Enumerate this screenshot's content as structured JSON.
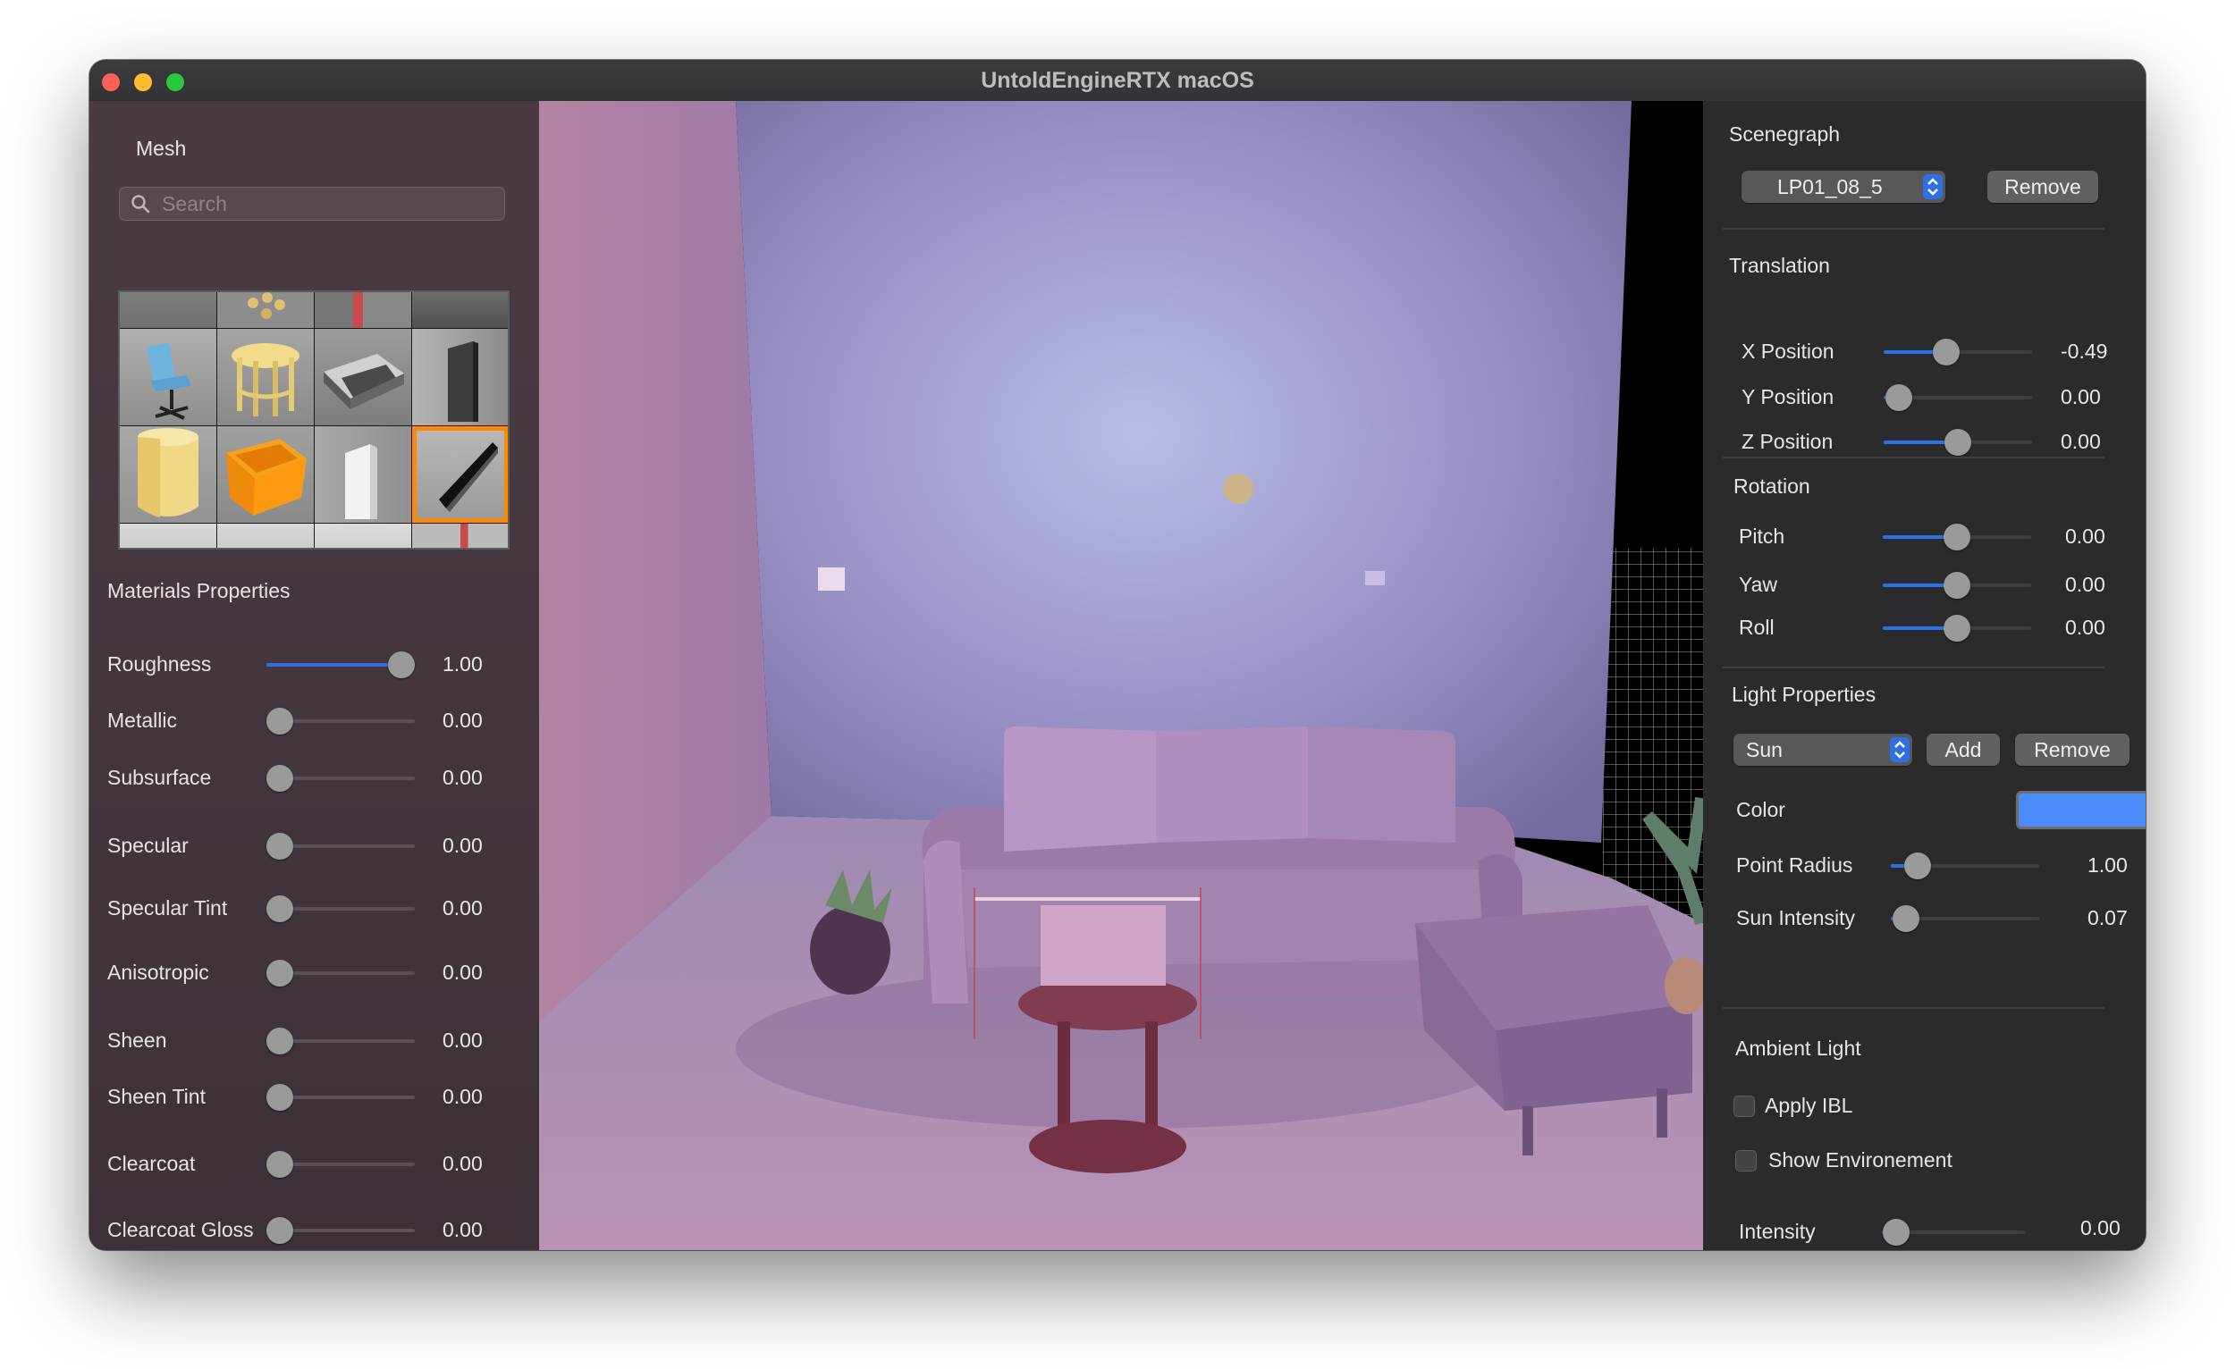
{
  "window": {
    "title": "UntoldEngineRTX macOS"
  },
  "left_panel": {
    "mesh_label": "Mesh",
    "search_placeholder": "Search",
    "materials_title": "Materials Properties",
    "materials": [
      {
        "label": "Roughness",
        "value": "1.00",
        "level": 1.0
      },
      {
        "label": "Metallic",
        "value": "0.00",
        "level": 0.0
      },
      {
        "label": "Subsurface",
        "value": "0.00",
        "level": 0.0
      },
      {
        "label": "Specular",
        "value": "0.00",
        "level": 0.0
      },
      {
        "label": "Specular Tint",
        "value": "0.00",
        "level": 0.0
      },
      {
        "label": "Anisotropic",
        "value": "0.00",
        "level": 0.0
      },
      {
        "label": "Sheen",
        "value": "0.00",
        "level": 0.0
      },
      {
        "label": "Sheen Tint",
        "value": "0.00",
        "level": 0.0
      },
      {
        "label": "Clearcoat",
        "value": "0.00",
        "level": 0.0
      },
      {
        "label": "Clearcoat Gloss",
        "value": "0.00",
        "level": 0.0
      }
    ]
  },
  "right_panel": {
    "scenegraph_title": "Scenegraph",
    "scenegraph_selected": "LP01_08_5",
    "remove_label": "Remove",
    "translation_title": "Translation",
    "translation": [
      {
        "label": "X Position",
        "value": "-0.49",
        "level": 0.42
      },
      {
        "label": "Y Position",
        "value": "0.00",
        "level": 0.1
      },
      {
        "label": "Z Position",
        "value": "0.00",
        "level": 0.5
      }
    ],
    "rotation_title": "Rotation",
    "rotation": [
      {
        "label": "Pitch",
        "value": "0.00",
        "level": 0.5
      },
      {
        "label": "Yaw",
        "value": "0.00",
        "level": 0.5
      },
      {
        "label": "Roll",
        "value": "0.00",
        "level": 0.5
      }
    ],
    "light_title": "Light Properties",
    "light_selected": "Sun",
    "add_label": "Add",
    "light_remove_label": "Remove",
    "color_label": "Color",
    "color_value": "#4a8bf9",
    "light_sliders": [
      {
        "label": "Point Radius",
        "value": "1.00",
        "level": 0.18
      },
      {
        "label": "Sun Intensity",
        "value": "0.07",
        "level": 0.1
      }
    ],
    "ambient_title": "Ambient Light",
    "apply_ibl_label": "Apply IBL",
    "show_env_label": "Show Environement",
    "intensity_label": "Intensity",
    "intensity_value": "0.00",
    "intensity_level": 0.1
  }
}
